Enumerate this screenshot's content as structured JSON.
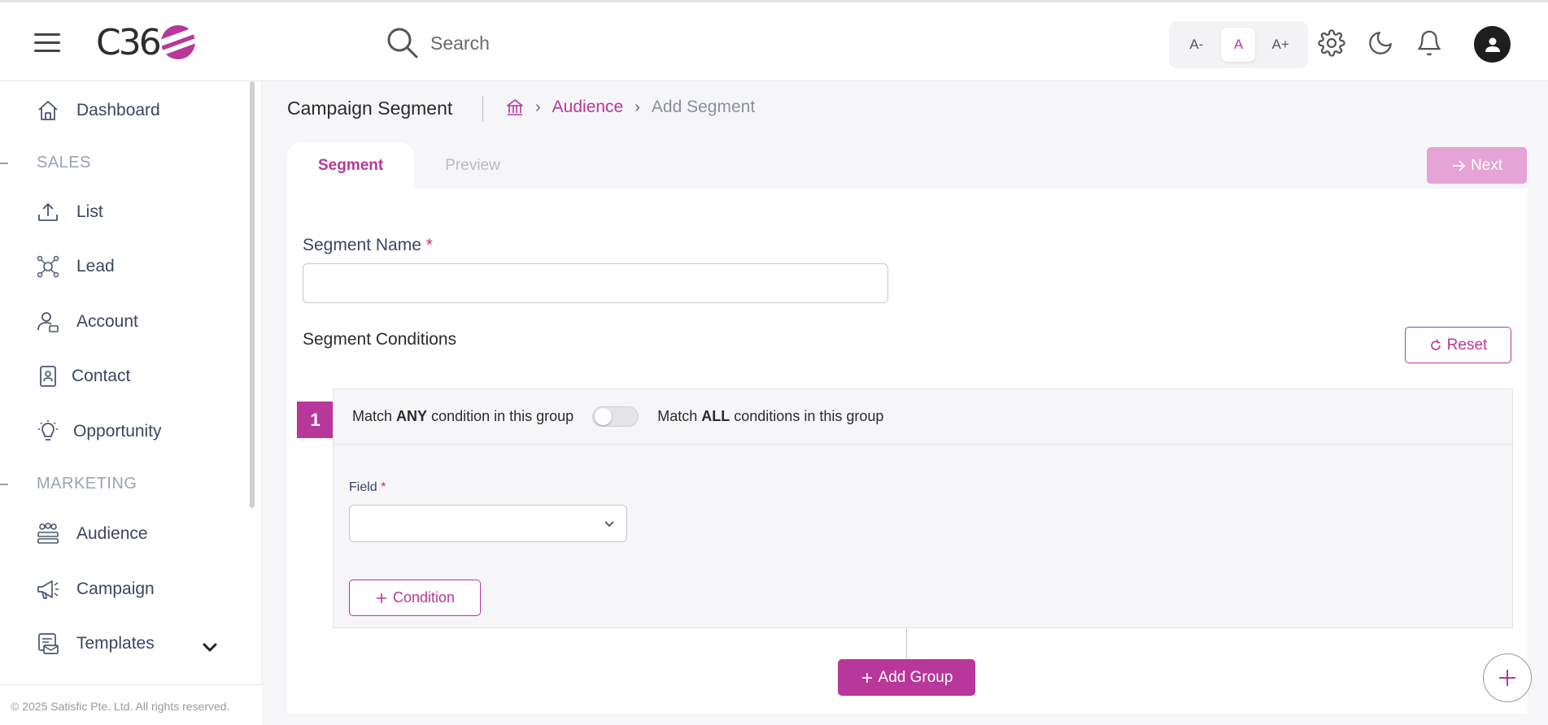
{
  "header": {
    "logo_text": "C36",
    "search_placeholder": "Search",
    "font_sizes": [
      "A-",
      "A",
      "A+"
    ],
    "icons": [
      "menu-icon",
      "search-icon",
      "gear-icon",
      "moon-icon",
      "bell-icon",
      "user-icon"
    ]
  },
  "sidebar": {
    "items": [
      {
        "label": "Dashboard",
        "icon": "home-icon"
      },
      {
        "label": "List",
        "icon": "upload-icon"
      },
      {
        "label": "Lead",
        "icon": "network-icon"
      },
      {
        "label": "Account",
        "icon": "account-icon"
      },
      {
        "label": "Contact",
        "icon": "contact-icon"
      },
      {
        "label": "Opportunity",
        "icon": "bulb-icon"
      },
      {
        "label": "Audience",
        "icon": "audience-icon"
      },
      {
        "label": "Campaign",
        "icon": "megaphone-icon"
      },
      {
        "label": "Templates",
        "icon": "template-icon"
      }
    ],
    "sections": [
      "SALES",
      "MARKETING"
    ],
    "footer": "© 2025 Satisfic Pte. Ltd. All rights reserved."
  },
  "page": {
    "title": "Campaign Segment",
    "breadcrumb": {
      "link": "Audience",
      "current": "Add Segment"
    },
    "tabs": [
      "Segment",
      "Preview"
    ],
    "next_label": "Next"
  },
  "form": {
    "segment_name_label": "Segment Name",
    "required_mark": "*",
    "segment_name_value": "",
    "conditions_title": "Segment Conditions",
    "reset_label": "Reset",
    "group": {
      "number": "1",
      "match_prefix": "Match",
      "any_word": "ANY",
      "any_suffix": "condition in this group",
      "all_word": "ALL",
      "all_suffix": "conditions in this group",
      "field_label": "Field",
      "condition_label": "Condition"
    },
    "add_group_label": "Add Group"
  },
  "colors": {
    "accent": "#b8379a",
    "accent_light": "#e5a3d6",
    "text": "#3a4660",
    "muted": "#9aa3b2"
  }
}
